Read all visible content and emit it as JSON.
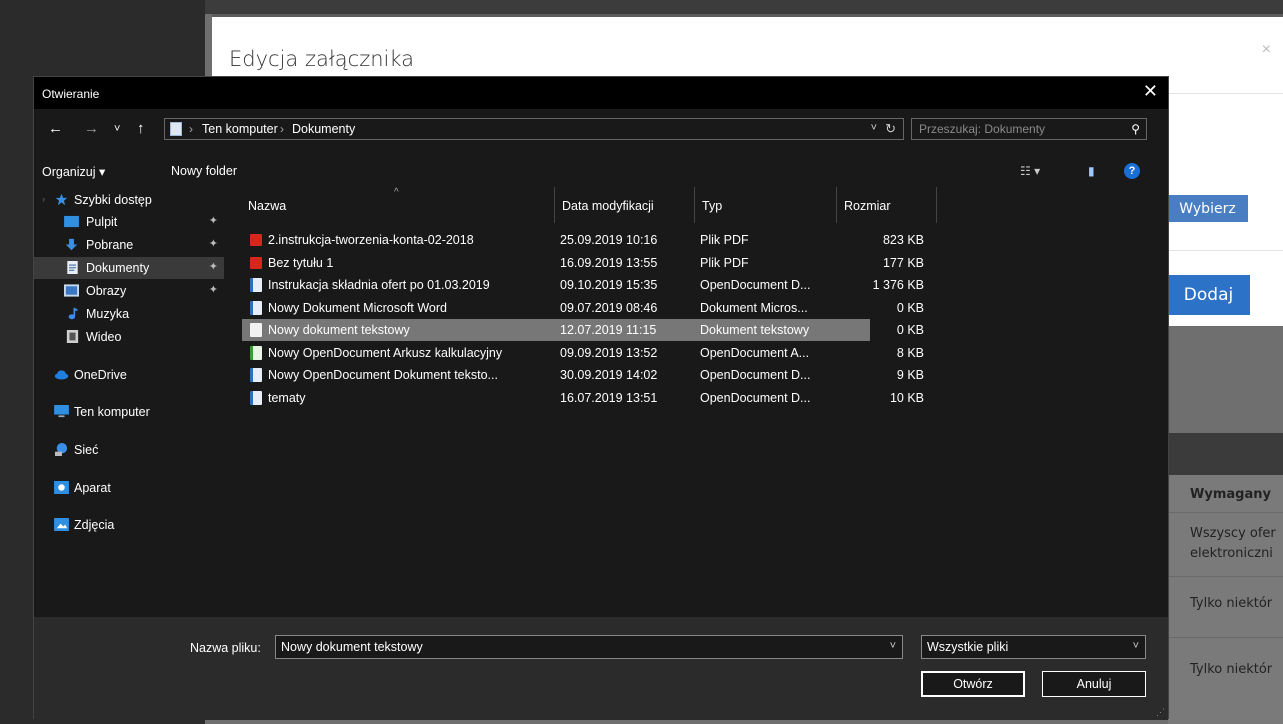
{
  "background": {
    "modal_title": "Edycja załącznika",
    "modal_close": "×",
    "choose_button": "Wybierz",
    "add_button": "Dodaj",
    "table_header": "Wymagany",
    "table_cells": [
      "Wszyscy ofer",
      "elektroniczni",
      "Tylko niektór",
      "Tylko niektór"
    ]
  },
  "dialog": {
    "title": "Otwieranie",
    "close": "✕",
    "nav": {
      "back": "←",
      "forward": "→",
      "recent": "˅",
      "up": "↑",
      "breadcrumb": [
        "Ten komputer",
        "Dokumenty"
      ],
      "breadcrumb_sep": "›",
      "address_dropdown": "˅",
      "refresh": "↻",
      "search_placeholder": "Przeszukaj: Dokumenty",
      "search_icon": "⚲"
    },
    "toolbar": {
      "organize": "Organizuj ▾",
      "new_folder": "Nowy folder",
      "view_icon": "☷ ▾",
      "preview_icon": "▮",
      "help": "?"
    },
    "sidebar": {
      "items": [
        {
          "label": "Szybki dostęp",
          "icon": "star-icon",
          "pinned": false
        },
        {
          "label": "Pulpit",
          "icon": "desktop-icon",
          "pinned": true
        },
        {
          "label": "Pobrane",
          "icon": "download-icon",
          "pinned": true
        },
        {
          "label": "Dokumenty",
          "icon": "documents-icon",
          "pinned": true,
          "selected": true
        },
        {
          "label": "Obrazy",
          "icon": "pictures-icon",
          "pinned": true
        },
        {
          "label": "Muzyka",
          "icon": "music-icon",
          "pinned": false
        },
        {
          "label": "Wideo",
          "icon": "video-icon",
          "pinned": false
        },
        {
          "label": "OneDrive",
          "icon": "cloud-icon",
          "pinned": false
        },
        {
          "label": "Ten komputer",
          "icon": "computer-icon",
          "pinned": false
        },
        {
          "label": "Sieć",
          "icon": "network-icon",
          "pinned": false
        },
        {
          "label": "Aparat",
          "icon": "camera-icon",
          "pinned": false
        },
        {
          "label": "Zdjęcia",
          "icon": "photos-icon",
          "pinned": false
        }
      ],
      "pin_glyph": "📌"
    },
    "columns": [
      "Nazwa",
      "Data modyfikacji",
      "Typ",
      "Rozmiar"
    ],
    "sort_caret": "^",
    "files": [
      {
        "name": "2.instrukcja-tworzenia-konta-02-2018",
        "date": "25.09.2019 10:16",
        "type": "Plik PDF",
        "size": "823 KB",
        "icon": "pdf-icon"
      },
      {
        "name": "Bez tytułu 1",
        "date": "16.09.2019 13:55",
        "type": "Plik PDF",
        "size": "177 KB",
        "icon": "pdf-icon"
      },
      {
        "name": "Instrukacja składnia ofert po 01.03.2019",
        "date": "09.10.2019 15:35",
        "type": "OpenDocument D...",
        "size": "1 376 KB",
        "icon": "odt-icon"
      },
      {
        "name": "Nowy Dokument Microsoft Word",
        "date": "09.07.2019 08:46",
        "type": "Dokument Micros...",
        "size": "0 KB",
        "icon": "word-icon"
      },
      {
        "name": "Nowy dokument tekstowy",
        "date": "12.07.2019 11:15",
        "type": "Dokument tekstowy",
        "size": "0 KB",
        "icon": "text-file-icon",
        "selected": true
      },
      {
        "name": "Nowy OpenDocument Arkusz kalkulacyjny",
        "date": "09.09.2019 13:52",
        "type": "OpenDocument A...",
        "size": "8 KB",
        "icon": "ods-icon"
      },
      {
        "name": "Nowy OpenDocument Dokument teksto...",
        "date": "30.09.2019 14:02",
        "type": "OpenDocument D...",
        "size": "9 KB",
        "icon": "odt-icon"
      },
      {
        "name": "tematy",
        "date": "16.07.2019 13:51",
        "type": "OpenDocument D...",
        "size": "10 KB",
        "icon": "odt-icon"
      }
    ],
    "bottom": {
      "filename_label": "Nazwa pliku:",
      "filename_value": "Nowy dokument tekstowy",
      "filename_dropdown": "˅",
      "filter_value": "Wszystkie pliki",
      "filter_dropdown": "˅",
      "open_button": "Otwórz",
      "cancel_button": "Anuluj",
      "resize_grip": "⋰"
    }
  }
}
